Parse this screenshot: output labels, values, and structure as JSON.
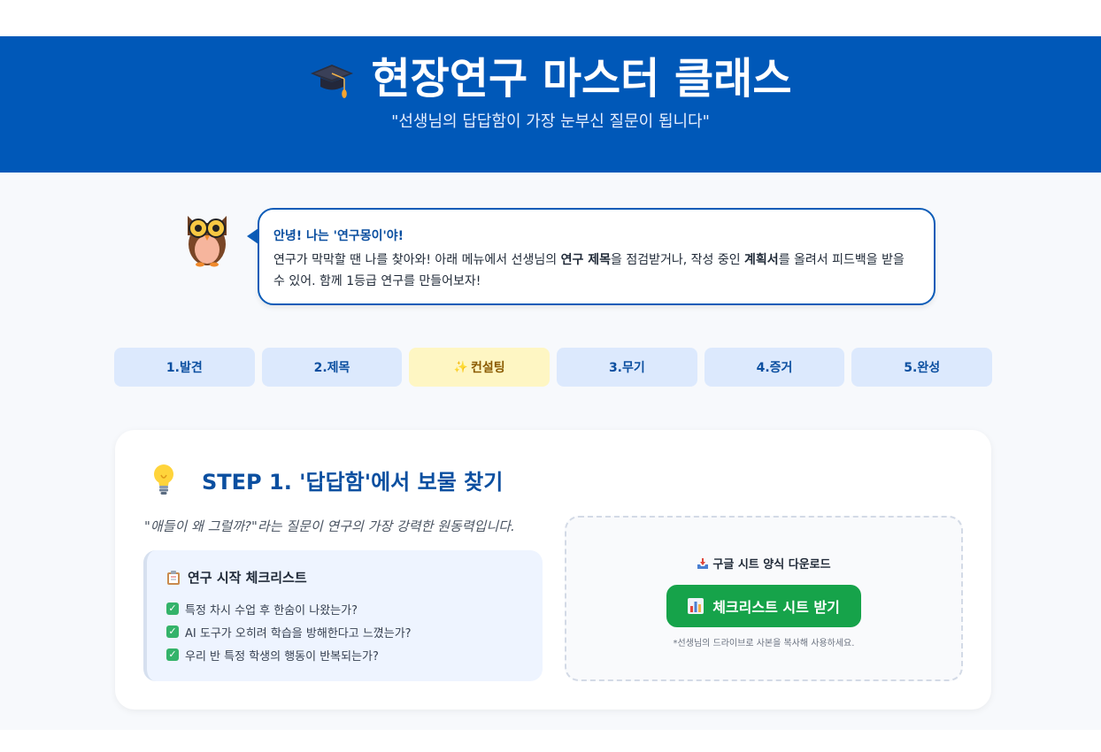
{
  "header": {
    "icon": "graduation-cap-icon",
    "title": "현장연구 마스터 클래스",
    "subtitle": "\"선생님의 답답함이 가장 눈부신 질문이 됩니다\""
  },
  "guide": {
    "icon": "owl-icon",
    "greeting": "안녕! 나는 '연구몽이'야!",
    "message_part1": "연구가 막막할 땐 나를 찾아와! 아래 메뉴에서 선생님의 ",
    "message_bold1": "연구 제목",
    "message_part2": "을 점검받거나, 작성 중인 ",
    "message_bold2": "계획서",
    "message_part3": "를 올려서 피드백을 받을 수 있어. 함께 1등급 연구를 만들어보자!"
  },
  "tabs": [
    {
      "label": "1.발견",
      "active": false
    },
    {
      "label": "2.제목",
      "active": false
    },
    {
      "label": "컨설팅",
      "icon": "sparkle-icon",
      "active": true
    },
    {
      "label": "3.무기",
      "active": false
    },
    {
      "label": "4.증거",
      "active": false
    },
    {
      "label": "5.완성",
      "active": false
    }
  ],
  "step": {
    "icon": "lightbulb-icon",
    "title": "STEP 1. '답답함'에서 보물 찾기",
    "quote": "\"애들이 왜 그럴까?\"라는 질문이 연구의 가장 강력한 원동력입니다.",
    "checklist": {
      "icon": "clipboard-icon",
      "title": "연구 시작 체크리스트",
      "items": [
        "특정 차시 수업 후 한숨이 나왔는가?",
        "AI 도구가 오히려 학습을 방해한다고 느꼈는가?",
        "우리 반 특정 학생의 행동이 반복되는가?"
      ]
    },
    "download": {
      "icon": "inbox-tray-icon",
      "label": "구글 시트 양식 다운로드",
      "button_icon": "bar-chart-icon",
      "button_label": "체크리스트 시트 받기",
      "note": "*선생님의 드라이브로 사본을 복사해 사용하세요."
    }
  },
  "colors": {
    "brand": "#0058b8",
    "tab_bg": "#dce9fd",
    "tab_active_bg": "#fef6c3",
    "button_green": "#16a34a"
  }
}
